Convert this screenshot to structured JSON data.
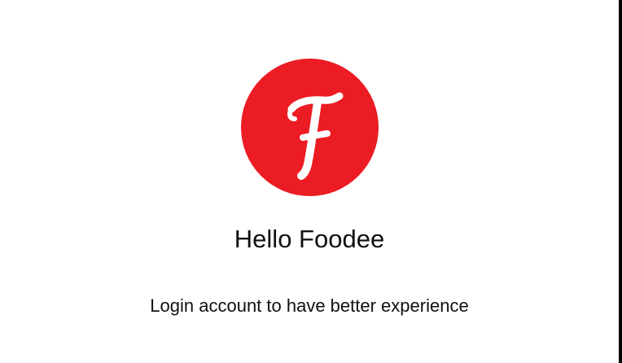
{
  "logo": {
    "icon": "foodee-f-logo-icon",
    "letter": "F",
    "background_color": "#ec1c24",
    "letter_color": "#ffffff"
  },
  "welcome": {
    "title": "Hello Foodee",
    "subtitle": "Login account to have better experience"
  }
}
